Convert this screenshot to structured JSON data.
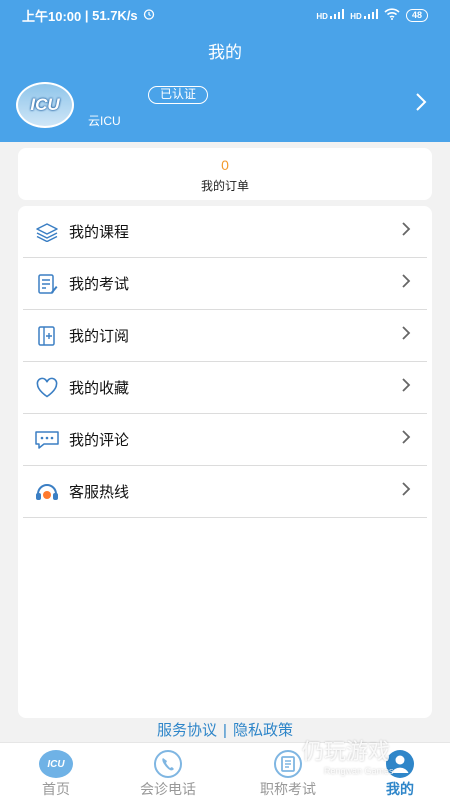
{
  "status_bar": {
    "time": "上午10:00",
    "speed": "51.7K/s",
    "signal1": "HD",
    "signal2": "HD",
    "battery": "48"
  },
  "header": {
    "title": "我的",
    "avatar_text": "ICU",
    "verified": "已认证",
    "username": "云ICU"
  },
  "orders": {
    "count": "0",
    "label": "我的订单"
  },
  "menu": [
    {
      "label": "我的课程",
      "icon": "layers-icon"
    },
    {
      "label": "我的考试",
      "icon": "exam-icon"
    },
    {
      "label": "我的订阅",
      "icon": "subscribe-icon"
    },
    {
      "label": "我的收藏",
      "icon": "heart-icon"
    },
    {
      "label": "我的评论",
      "icon": "comment-icon"
    },
    {
      "label": "客服热线",
      "icon": "headset-icon"
    }
  ],
  "links": {
    "service": "服务协议",
    "separator": "|",
    "privacy": "隐私政策"
  },
  "tabs": [
    {
      "label": "首页",
      "icon_text": "ICU"
    },
    {
      "label": "会诊电话"
    },
    {
      "label": "职称考试"
    },
    {
      "label": "我的"
    }
  ],
  "watermark": {
    "cn": "仍玩游戏",
    "en": "Rengwan Games"
  },
  "colors": {
    "accent": "#4aa3e9",
    "link": "#2f86c9",
    "order_count": "#f29b2e"
  }
}
